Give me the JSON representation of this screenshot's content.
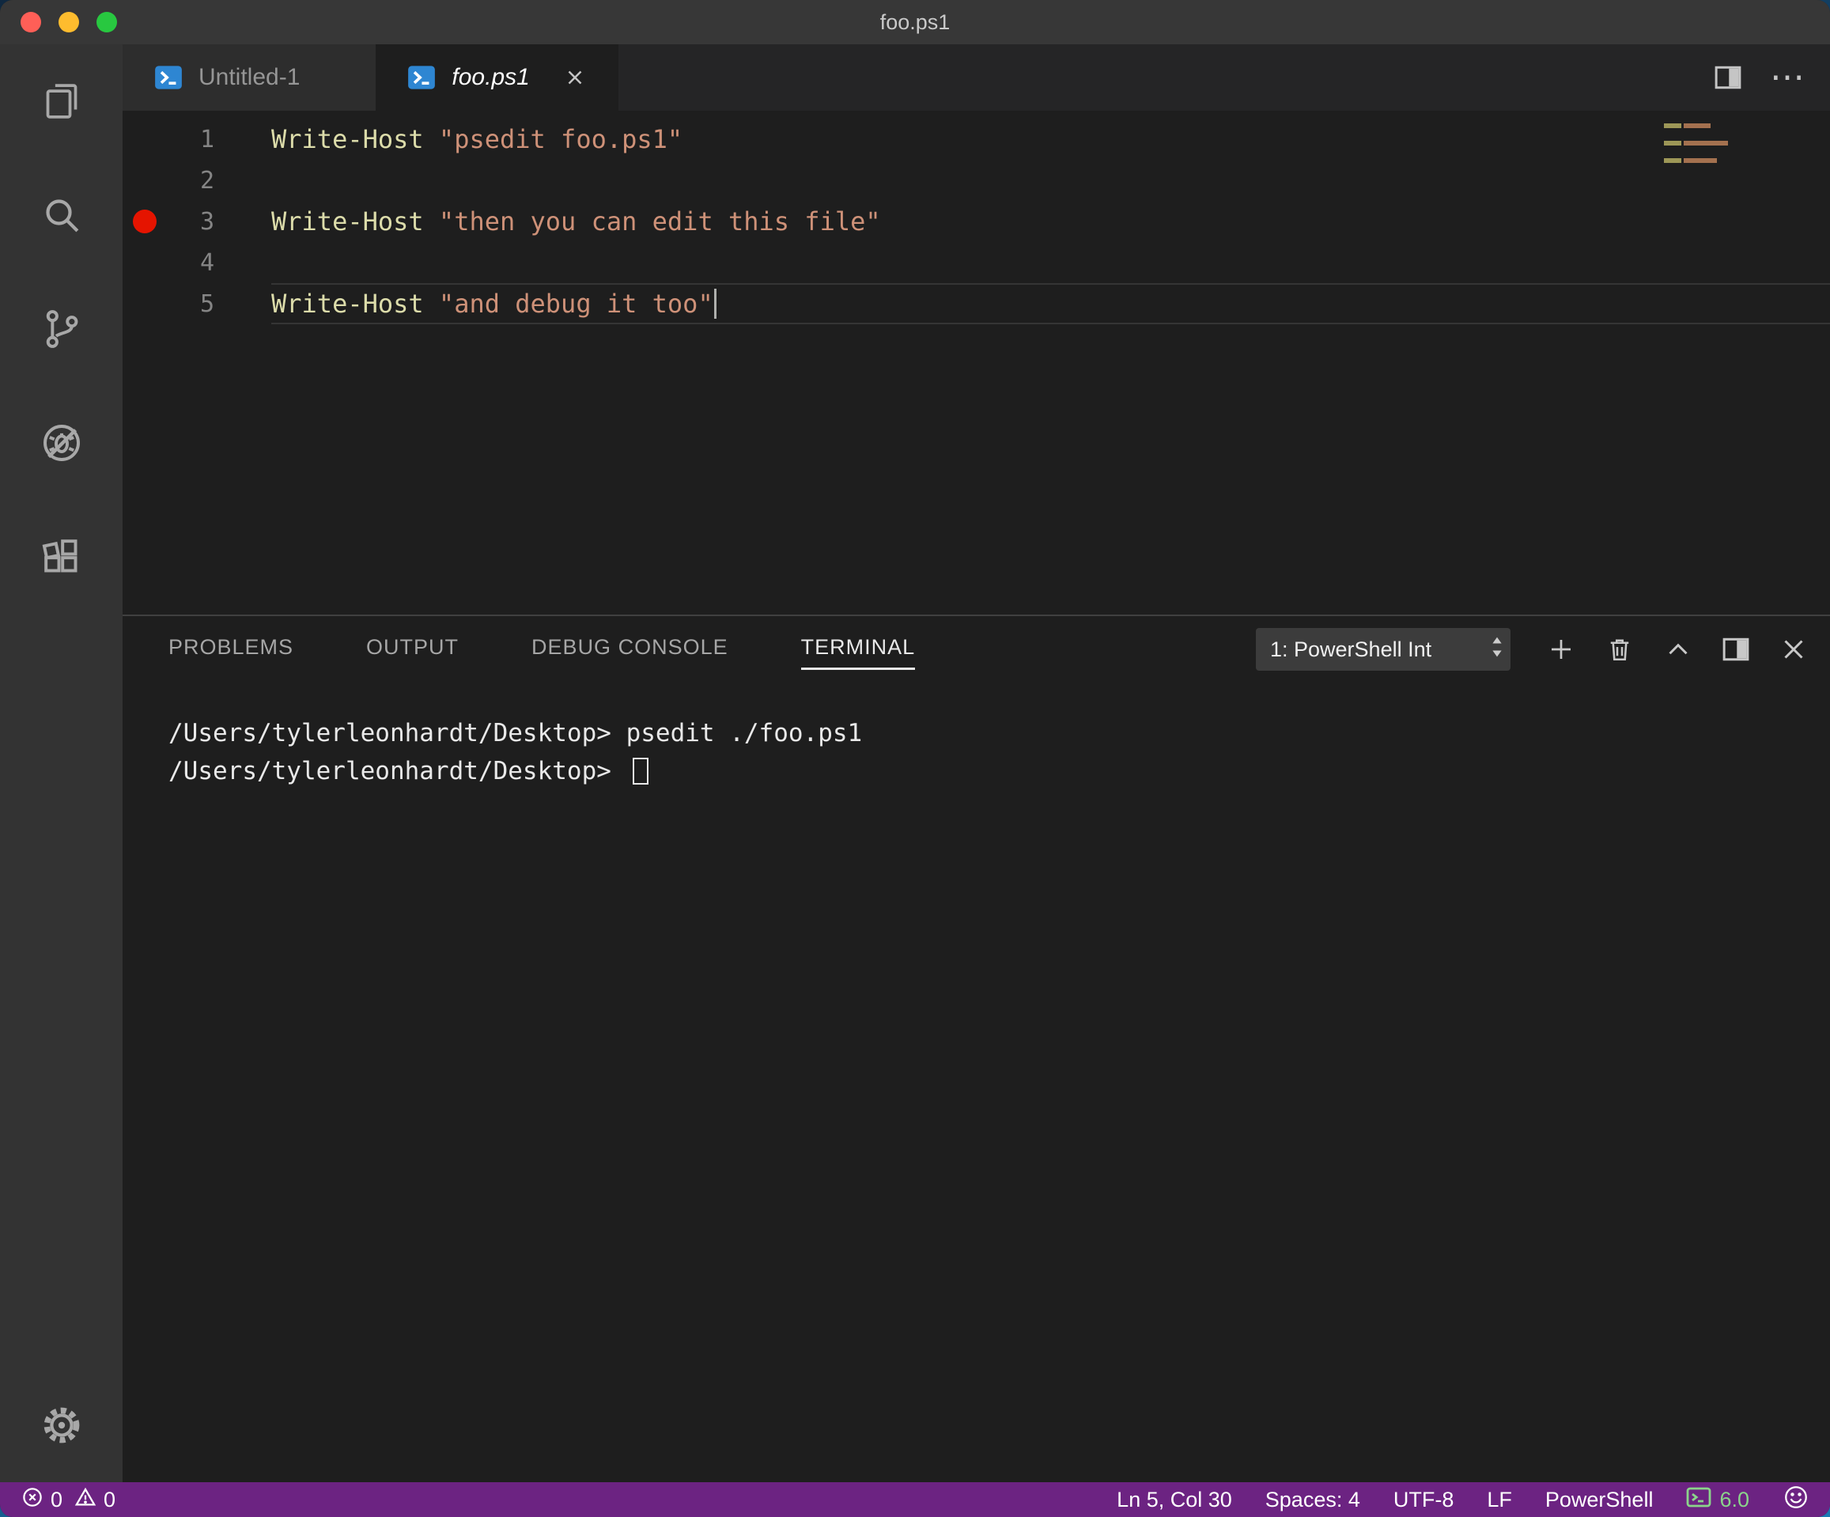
{
  "window": {
    "title": "foo.ps1"
  },
  "tabs": [
    {
      "label": "Untitled-1",
      "icon": "powershell",
      "active": false
    },
    {
      "label": "foo.ps1",
      "icon": "powershell",
      "active": true
    }
  ],
  "editor": {
    "lines": [
      {
        "number": "1",
        "breakpoint": false,
        "current": false,
        "cursor": false,
        "tokens": [
          {
            "type": "function",
            "text": "Write-Host"
          },
          {
            "type": "plain",
            "text": " "
          },
          {
            "type": "string",
            "text": "\"psedit foo.ps1\""
          }
        ]
      },
      {
        "number": "2",
        "breakpoint": false,
        "current": false,
        "cursor": false,
        "tokens": []
      },
      {
        "number": "3",
        "breakpoint": true,
        "current": false,
        "cursor": false,
        "tokens": [
          {
            "type": "function",
            "text": "Write-Host"
          },
          {
            "type": "plain",
            "text": " "
          },
          {
            "type": "string",
            "text": "\"then you can edit this file\""
          }
        ]
      },
      {
        "number": "4",
        "breakpoint": false,
        "current": false,
        "cursor": false,
        "tokens": []
      },
      {
        "number": "5",
        "breakpoint": false,
        "current": true,
        "cursor": true,
        "tokens": [
          {
            "type": "function",
            "text": "Write-Host"
          },
          {
            "type": "plain",
            "text": " "
          },
          {
            "type": "string",
            "text": "\"and debug it too\""
          }
        ]
      }
    ]
  },
  "panel": {
    "tabs": [
      {
        "label": "PROBLEMS",
        "active": false
      },
      {
        "label": "OUTPUT",
        "active": false
      },
      {
        "label": "DEBUG CONSOLE",
        "active": false
      },
      {
        "label": "TERMINAL",
        "active": true
      }
    ],
    "terminal_picker": "1: PowerShell Int",
    "terminal_lines": [
      {
        "prompt": "/Users/tylerleonhardt/Desktop>",
        "command": " psedit ./foo.ps1",
        "cursor": false
      },
      {
        "prompt": "/Users/tylerleonhardt/Desktop>",
        "command": " ",
        "cursor": true
      }
    ]
  },
  "status_bar": {
    "errors": "0",
    "warnings": "0",
    "right_items": [
      "Ln 5, Col 30",
      "Spaces: 4",
      "UTF-8",
      "LF",
      "PowerShell"
    ],
    "ps_version": "6.0"
  },
  "colors": {
    "function": "#dcdcaa",
    "string": "#ce9178",
    "plain": "#d4d4d4",
    "status_bar": "#6c2382",
    "breakpoint": "#e51400",
    "version_green": "#8bd48b",
    "powershell_blue": "#2e86d2"
  }
}
